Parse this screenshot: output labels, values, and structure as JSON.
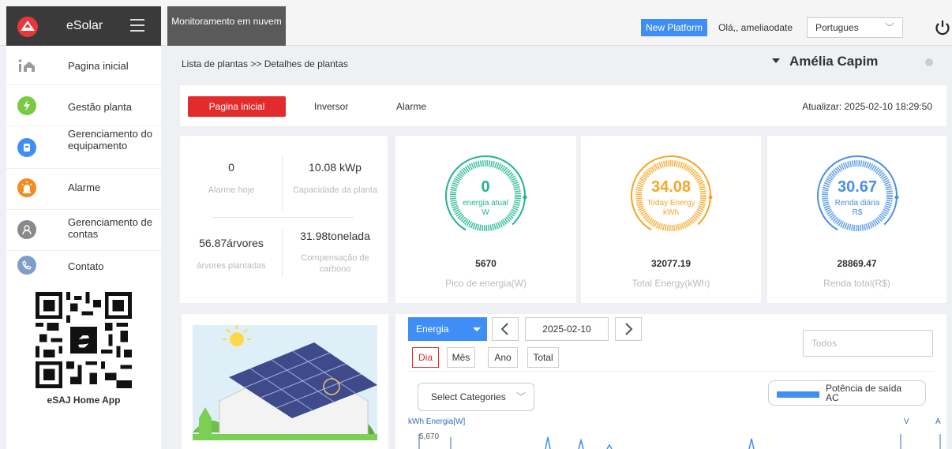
{
  "topbar": {
    "app_name": "eSolar",
    "monitor_tab": "Monitoramento em nuvem",
    "new_platform": "New Platform",
    "greeting": "Olá,, ameliaodate",
    "language": "Portugues"
  },
  "sidebar": {
    "items": [
      {
        "label": "Pagina inicial",
        "icon": "home-icon",
        "color": "#9b9b9b"
      },
      {
        "label": "Gestão planta",
        "icon": "lightning-icon",
        "color": "#7ac943"
      },
      {
        "label": "Gerenciamento do equipamento",
        "icon": "device-icon",
        "color": "#3f8ef5"
      },
      {
        "label": "Alarme",
        "icon": "alarm-icon",
        "color": "#f58a1f"
      },
      {
        "label": "Gerenciamento de contas",
        "icon": "account-icon",
        "color": "#8a8a8a"
      },
      {
        "label": "Contato",
        "icon": "phone-icon",
        "color": "#7f9fc8"
      }
    ],
    "qr_caption": "eSAJ Home App"
  },
  "breadcrumb": "Lista de plantas >> Detalhes de plantas",
  "plant_name": "Amélia Capim",
  "tabs": {
    "items": [
      "Pagina inicial",
      "Inversor",
      "Alarme"
    ],
    "active": "Pagina inicial",
    "update": "Atualizar: 2025-02-10 18:29:50"
  },
  "stats": {
    "alarm_today_value": "0",
    "alarm_today_label": "Alarme hoje",
    "capacity_value": "10.08 kWp",
    "capacity_label": "Capacidade da planta",
    "trees_value": "56.87árvores",
    "trees_label": "árvores plantadas",
    "carbon_value": "31.98tonelada",
    "carbon_label": "Compensação de carbono"
  },
  "gauges": [
    {
      "value": "0",
      "label": "energia atual",
      "unit": "W",
      "total_value": "5670",
      "total_label": "Pico de energia(W)",
      "color": "#1fb58f"
    },
    {
      "value": "34.08",
      "label": "Today Energy",
      "unit": "kWh",
      "total_value": "32077.19",
      "total_label": "Total Energy(kWh)",
      "color": "#f5a623"
    },
    {
      "value": "30.67",
      "label": "Renda diária",
      "unit": "R$",
      "total_value": "28869.47",
      "total_label": "Renda total(R$)",
      "color": "#4a90e2"
    }
  ],
  "chart_controls": {
    "metric": "Energia",
    "date": "2025-02-10",
    "periods": [
      "Dia",
      "Mês",
      "Ano",
      "Total"
    ],
    "active_period": "Dia",
    "filter_placeholder": "Todos",
    "categories_placeholder": "Select Categories",
    "legend": "Potência de saída AC",
    "y_left_label": "kWh Energia[W]",
    "y_tick_top": "5,670",
    "y_right_v": "V",
    "y_right_a": "A"
  }
}
